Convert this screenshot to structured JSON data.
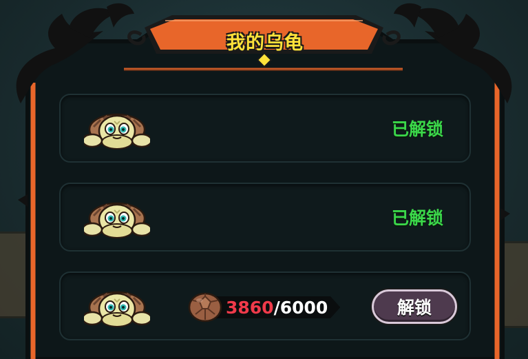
{
  "panel": {
    "title": "我的乌龟"
  },
  "turtles": [
    {
      "icon": "turtle-icon",
      "status": "已解锁"
    },
    {
      "icon": "turtle-icon",
      "status": "已解锁"
    },
    {
      "icon": "turtle-icon",
      "cost": {
        "icon": "turtle-shell-icon",
        "current": "3860",
        "separator": "/",
        "required": "6000"
      },
      "unlock_button": "解锁"
    }
  ],
  "colors": {
    "frame_orange": "#e8662a",
    "title_yellow": "#ffe23a",
    "unlocked_green": "#3bd84a",
    "cost_red": "#f03a4a",
    "button_purple": "#4e3a4e"
  }
}
